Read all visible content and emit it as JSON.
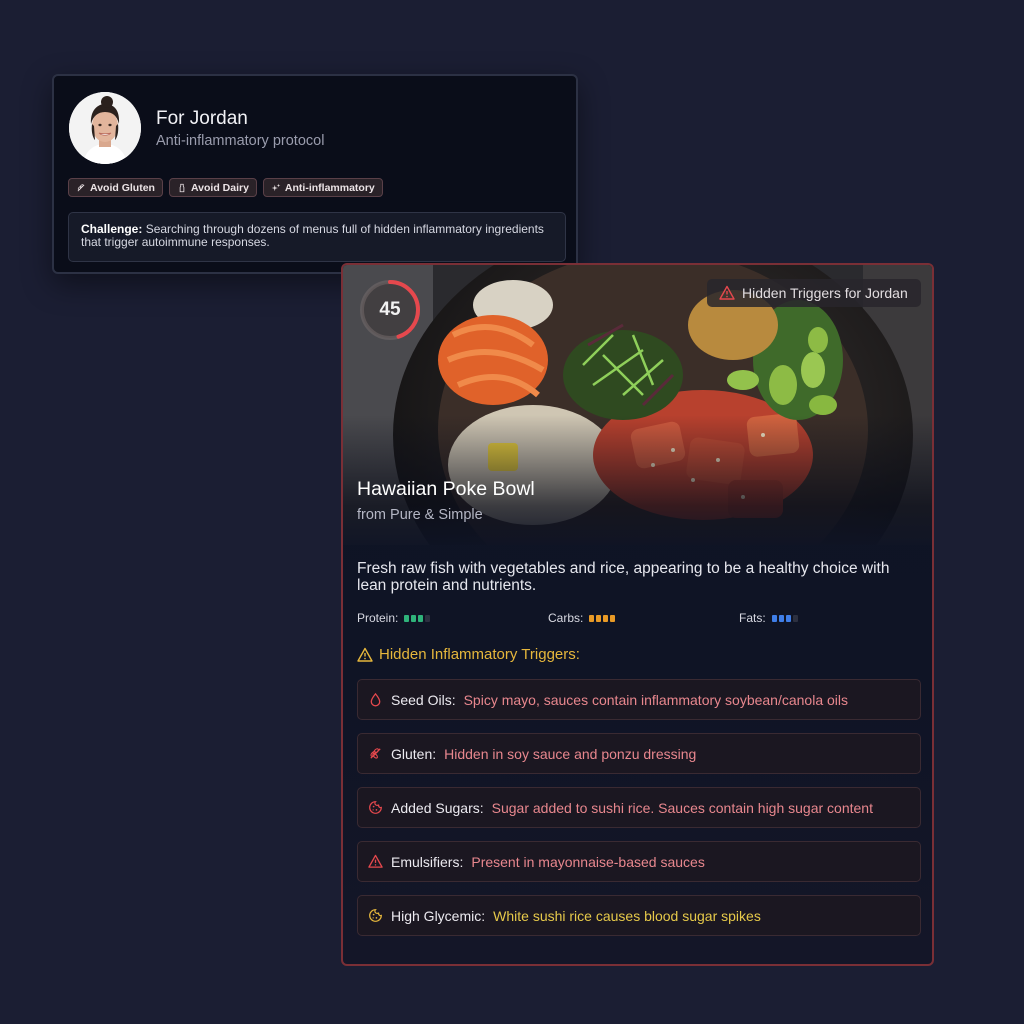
{
  "profile": {
    "name": "For Jordan",
    "protocol": "Anti-inflammatory protocol",
    "tags": [
      {
        "label": "Avoid Gluten",
        "icon": "wheat-icon"
      },
      {
        "label": "Avoid Dairy",
        "icon": "milk-bottle-icon"
      },
      {
        "label": "Anti-inflammatory",
        "icon": "sparkle-icon"
      }
    ],
    "challenge_label": "Challenge:",
    "challenge_text": "Searching through dozens of menus full of hidden inflammatory ingredients that trigger autoimmune responses."
  },
  "meal": {
    "score": "45",
    "score_fraction": 0.45,
    "badge_label": "Hidden Triggers for Jordan",
    "title": "Hawaiian Poke Bowl",
    "source": "from Pure & Simple",
    "description": "Fresh raw fish with vegetables and rice, appearing to be a healthy choice with lean protein and nutrients.",
    "macros": [
      {
        "label": "Protein:",
        "filled": 3,
        "total": 4,
        "color": "#2fb37a"
      },
      {
        "label": "Carbs:",
        "filled": 4,
        "total": 4,
        "color": "#e89a26"
      },
      {
        "label": "Fats:",
        "filled": 3,
        "total": 4,
        "color": "#3f7ee8"
      }
    ],
    "triggers_heading": "Hidden Inflammatory Triggers:",
    "triggers": [
      {
        "name": "Seed Oils:",
        "detail": "Spicy mayo, sauces contain inflammatory soybean/canola oils",
        "icon": "droplet-icon",
        "tone": "red"
      },
      {
        "name": "Gluten:",
        "detail": "Hidden in soy sauce and ponzu dressing",
        "icon": "wheat-icon",
        "tone": "red"
      },
      {
        "name": "Added Sugars:",
        "detail": "Sugar added to sushi rice. Sauces contain high sugar content",
        "icon": "cookie-icon",
        "tone": "red"
      },
      {
        "name": "Emulsifiers:",
        "detail": "Present in mayonnaise-based sauces",
        "icon": "warning-icon",
        "tone": "red"
      },
      {
        "name": "High Glycemic:",
        "detail": "White sushi rice causes blood sugar spikes",
        "icon": "cookie-icon",
        "tone": "yellow"
      }
    ]
  },
  "colors": {
    "background": "#1b1e33",
    "accent_red": "#e5484d",
    "accent_yellow": "#e6b73c"
  }
}
